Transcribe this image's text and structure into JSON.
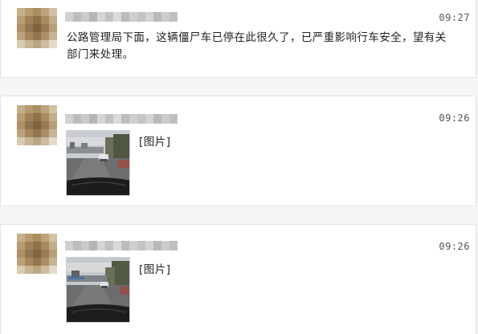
{
  "colors": {
    "card_background": "#ffffff",
    "page_background": "#f5f5f5",
    "text": "#222222",
    "time_text": "#555555"
  },
  "posts": [
    {
      "time": "09:27",
      "message": "公路管理局下面，这辆僵尸车已停在此很久了，已严重影响行车安全，望有关部门来处理。",
      "avatar_icon": "pixelated-avatar-icon",
      "nickname_icon": "pixelated-nickname-icon"
    },
    {
      "time": "09:26",
      "image_tag": "[图片]",
      "avatar_icon": "pixelated-avatar-icon",
      "nickname_icon": "pixelated-nickname-icon"
    },
    {
      "time": "09:26",
      "image_tag": "[图片]",
      "avatar_icon": "pixelated-avatar-icon",
      "nickname_icon": "pixelated-nickname-icon"
    }
  ]
}
